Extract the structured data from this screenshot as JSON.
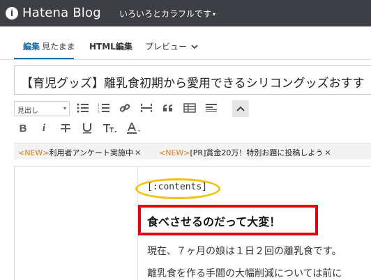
{
  "header": {
    "logo_icon": "hatena-logo-icon",
    "app_title": "Hatena Blog",
    "blog_name": "いろいろとカラフルです"
  },
  "tabs": {
    "edit_label": "編集",
    "edit_sub": "見たまま",
    "html_label": "HTML編集",
    "preview_label": "プレビュー"
  },
  "title_field": {
    "value": "【育児グッズ】離乳食初期から愛用できるシリコングッズおすす"
  },
  "toolbar": {
    "heading_select": "見出し",
    "icons_row1": [
      "unordered-list-icon",
      "ordered-list-icon",
      "link-icon",
      "horizontal-rule-icon",
      "quote-icon",
      "table-icon",
      "more-icon",
      "collapse-icon"
    ],
    "icons_row2": [
      "bold-icon",
      "italic-icon",
      "strikethrough-icon",
      "underline-icon",
      "font-size-icon",
      "text-color-icon"
    ]
  },
  "notices": [
    {
      "badge": "<NEW>",
      "text": "利用者アンケート実施中"
    },
    {
      "badge": "<NEW>",
      "text": "[PR]賞金20万！特別お題に投稿しよう"
    }
  ],
  "editor": {
    "contents_tag": "[:contents]",
    "heading": "食べさせるのだって大変！",
    "paragraphs": [
      "現在、７ヶ月の娘は１日２回の離乳食です。",
      "離乳食を作る手間の大幅削減については前に"
    ]
  },
  "colors": {
    "topbar": "#3d3f44",
    "accent": "#1c6ba7",
    "badge_orange": "#e87d1e",
    "highlight_oval": "#f2c200",
    "highlight_box": "#e60012"
  }
}
